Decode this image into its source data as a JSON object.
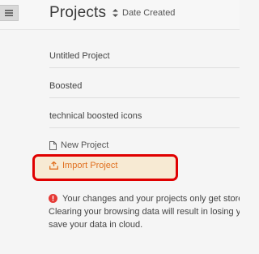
{
  "header": {
    "title": "Projects",
    "sort_label": "Date Created"
  },
  "icons": {
    "menu": "hamburger-menu-icon",
    "sort": "sort-arrows-icon",
    "new_project": "file-icon",
    "import_project": "upload-icon",
    "warning": "exclamation-circle-icon"
  },
  "projects": [
    {
      "name": "Untitled Project"
    },
    {
      "name": "Boosted"
    },
    {
      "name": "technical boosted icons"
    }
  ],
  "actions": {
    "new_project_label": "New Project",
    "import_project_label": "Import Project"
  },
  "warning": {
    "line1": "Your changes and your projects only get store",
    "line2": "Clearing your browsing data will result in losing y",
    "line3": "save your data in cloud."
  },
  "colors": {
    "accent": "#e07020",
    "highlight_border": "#e00000",
    "highlight_fill": "#f7ead3",
    "warning_icon": "#e53935"
  }
}
